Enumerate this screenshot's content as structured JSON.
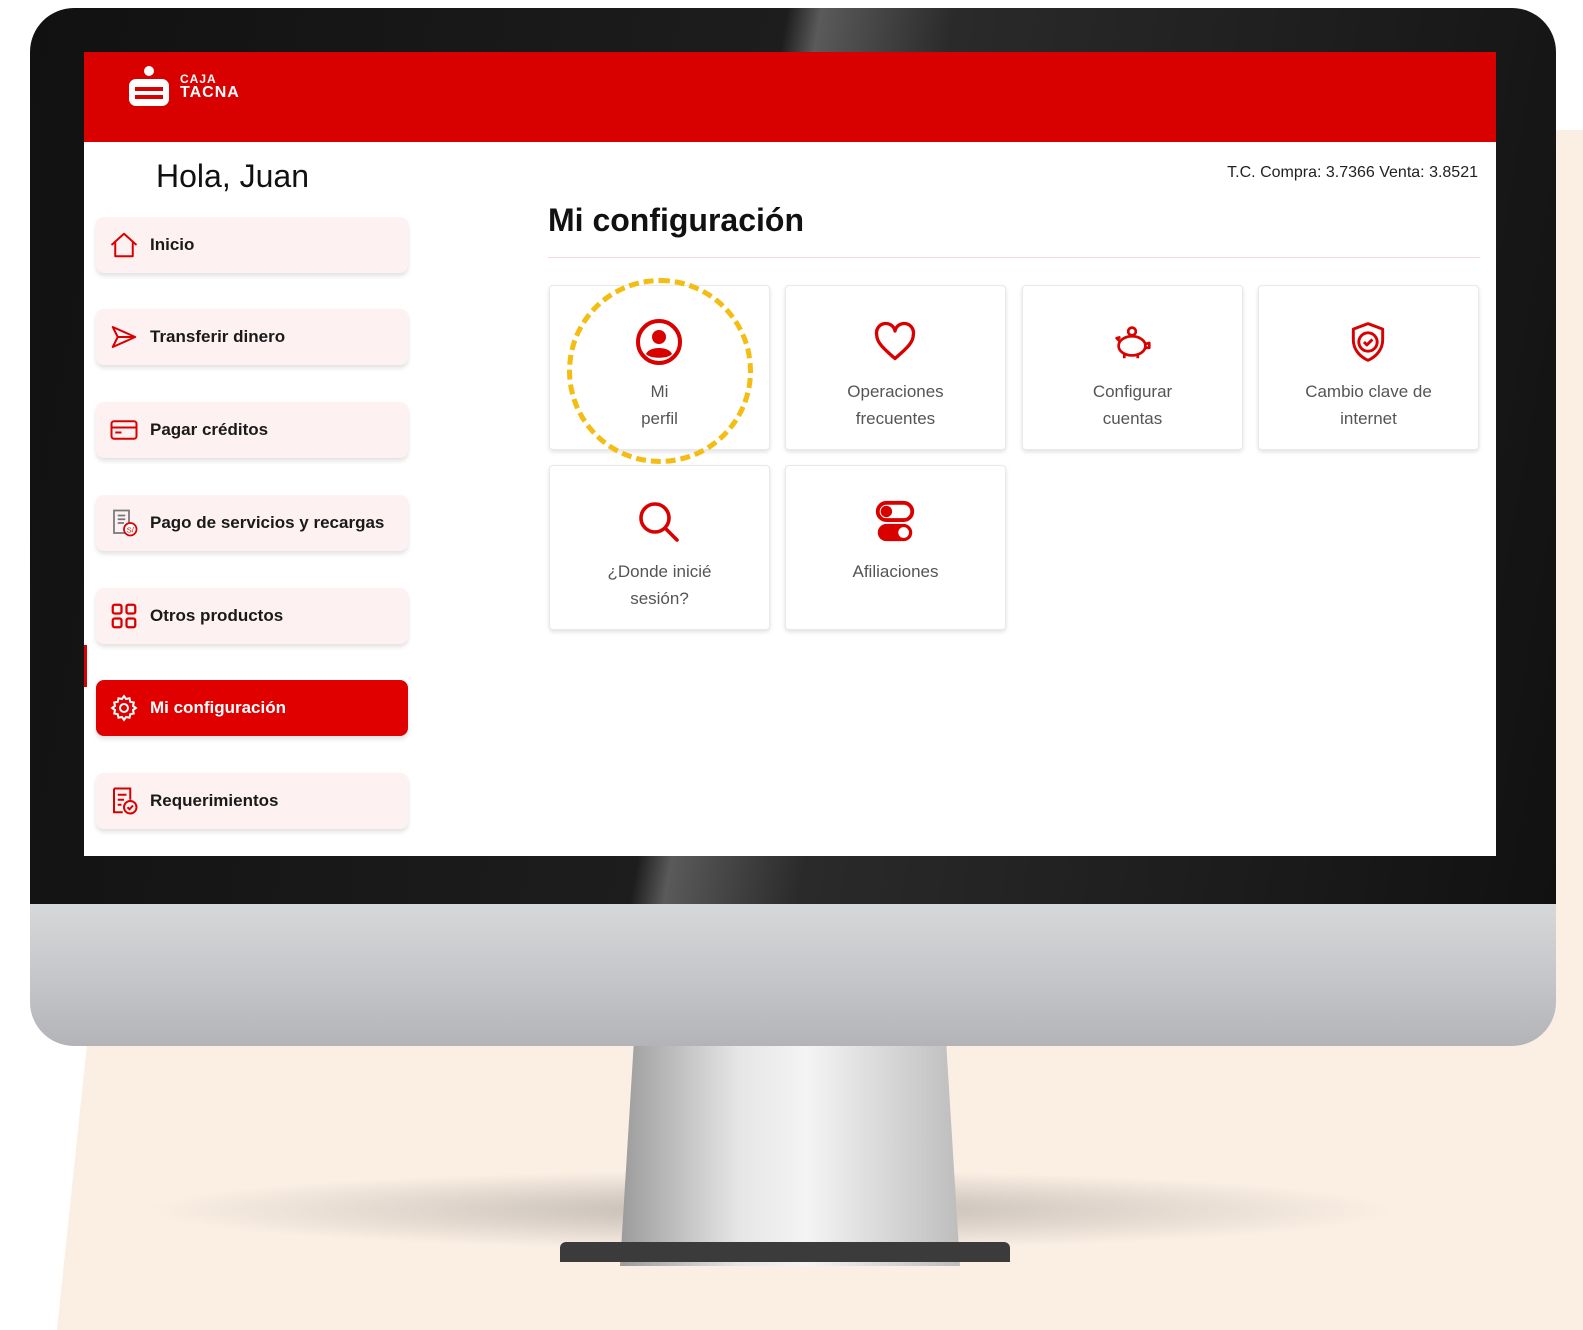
{
  "brand": {
    "name_line1": "CAJA",
    "name_line2": "TACNA",
    "primary_color": "#d90000",
    "highlight_color": "#f3bd13"
  },
  "greeting": "Hola, Juan",
  "exchange_rate": "T.C. Compra: 3.7366 Venta: 3.8521",
  "sidebar": {
    "items": [
      {
        "label": "Inicio",
        "icon": "home-icon",
        "active": false
      },
      {
        "label": "Transferir dinero",
        "icon": "send-icon",
        "active": false
      },
      {
        "label": "Pagar créditos",
        "icon": "card-icon",
        "active": false
      },
      {
        "label": "Pago de servicios y recargas",
        "icon": "receipt-icon",
        "active": false
      },
      {
        "label": "Otros productos",
        "icon": "grid-icon",
        "active": false
      },
      {
        "label": "Mi configuración",
        "icon": "gear-icon",
        "active": true
      },
      {
        "label": "Requerimientos",
        "icon": "document-check-icon",
        "active": false
      }
    ]
  },
  "main": {
    "title": "Mi configuración",
    "cards": [
      {
        "line1": "Mi",
        "line2": "perfil",
        "icon": "user-circle-icon"
      },
      {
        "line1": "Operaciones",
        "line2": "frecuentes",
        "icon": "heart-icon"
      },
      {
        "line1": "Configurar",
        "line2": "cuentas",
        "icon": "piggy-bank-icon"
      },
      {
        "line1": "Cambio clave de",
        "line2": "internet",
        "icon": "shield-check-icon"
      },
      {
        "line1": "¿Donde inicié",
        "line2": "sesión?",
        "icon": "search-icon"
      },
      {
        "line1": "Afiliaciones",
        "line2": "",
        "icon": "toggle-icon"
      }
    ]
  }
}
